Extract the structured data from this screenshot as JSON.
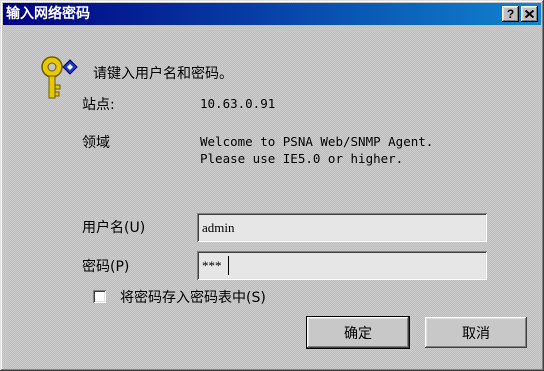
{
  "title_bar": {
    "title": "输入网络密码",
    "help_glyph": "?",
    "colors": {
      "start": "#000080",
      "end": "#1084d0",
      "text": "#ffffff"
    }
  },
  "icons": {
    "dialog": "key-icon",
    "help": "help-icon",
    "close": "close-icon"
  },
  "prompt": "请键入用户名和密码。",
  "site": {
    "label": "站点:",
    "value": "10.63.0.91"
  },
  "realm": {
    "label": "领域",
    "lines": [
      "Welcome to PSNA Web/SNMP Agent.",
      "Please use IE5.0 or higher."
    ]
  },
  "form": {
    "username": {
      "label": "用户名(U)",
      "value": "admin"
    },
    "password": {
      "label": "密码(P)",
      "value": "***"
    },
    "save_password": {
      "label": "将密码存入密码表中(S)",
      "checked": false
    }
  },
  "buttons": {
    "ok": "确定",
    "cancel": "取消"
  }
}
